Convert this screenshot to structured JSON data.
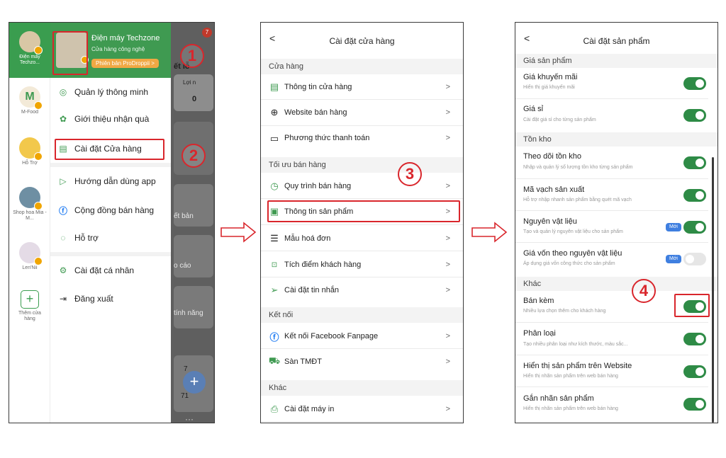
{
  "panel1": {
    "stores": [
      {
        "label": "Điện máy Techzo...",
        "active": true
      },
      {
        "label": "M-Food"
      },
      {
        "label": "Hỗ Trợ"
      },
      {
        "label": "Shop hoa Mia - M..."
      },
      {
        "label": "Len'Nii"
      },
      {
        "label": "Thêm cửa hàng"
      }
    ],
    "header": {
      "title": "Điện máy Techzone",
      "subtitle": "Cửa hàng công nghệ",
      "plan": "Phiên bản ProDroppii >"
    },
    "menu": [
      {
        "label": "Quản lý thông minh",
        "icon": "target-icon"
      },
      {
        "label": "Giới thiệu nhận quà",
        "icon": "gift-icon"
      },
      {
        "label": "Cài đặt Cửa hàng",
        "icon": "store-icon"
      },
      {
        "label": "Hướng dẫn dùng app",
        "icon": "play-icon"
      },
      {
        "label": "Cộng đồng bán hàng",
        "icon": "facebook-icon"
      },
      {
        "label": "Hỗ trợ",
        "icon": "chat-icon"
      },
      {
        "label": "Cài đặt cá nhân",
        "icon": "gear-icon"
      },
      {
        "label": "Đăng xuất",
        "icon": "logout-icon"
      }
    ],
    "background": {
      "badge": "7",
      "fragments": [
        "ết lỗ",
        "Lợi n",
        "0",
        "ết bản",
        "o cáo",
        "tính năng",
        "7",
        "71"
      ]
    }
  },
  "panel2": {
    "title": "Cài đặt cửa hàng",
    "sections": [
      {
        "title": "Cửa hàng",
        "items": [
          "Thông tin cửa hàng",
          "Website bán hàng",
          "Phương thức thanh toán"
        ]
      },
      {
        "title": "Tối ưu bán hàng",
        "items": [
          "Quy trình bán hàng",
          "Thông tin sản phẩm",
          "Mẫu hoá đơn",
          "Tích điểm khách hàng",
          "Cài đặt tin nhắn"
        ]
      },
      {
        "title": "Kết nối",
        "items": [
          "Kết nối Facebook Fanpage",
          "Sàn TMĐT"
        ]
      },
      {
        "title": "Khác",
        "items": [
          "Cài đặt máy in"
        ]
      }
    ]
  },
  "panel3": {
    "title": "Cài đặt sản phẩm",
    "sections": [
      {
        "title": "Giá sản phẩm",
        "items": [
          {
            "title": "Giá khuyến mãi",
            "desc": "Hiển thị giá khuyến mãi",
            "on": true
          },
          {
            "title": "Giá sỉ",
            "desc": "Cài đặt giá sỉ cho từng sản phẩm",
            "on": true
          }
        ]
      },
      {
        "title": "Tồn kho",
        "items": [
          {
            "title": "Theo dõi tồn kho",
            "desc": "Nhập và quản lý số lượng tồn kho từng sản phẩm",
            "on": true
          },
          {
            "title": "Mã vạch sản xuất",
            "desc": "Hỗ trợ nhập nhanh sản phẩm bằng quét mã vạch",
            "on": true
          },
          {
            "title": "Nguyên vật liệu",
            "desc": "Tạo và quản lý nguyên vật liệu cho sản phẩm",
            "on": true,
            "badge": "Mới"
          },
          {
            "title": "Giá vốn theo nguyên vật liệu",
            "desc": "Áp dụng giá vốn công thức cho sản phẩm",
            "on": false,
            "badge": "Mới"
          }
        ]
      },
      {
        "title": "Khác",
        "items": [
          {
            "title": "Bán kèm",
            "desc": "Nhiều lựa chọn thêm cho khách hàng",
            "on": true
          },
          {
            "title": "Phân loại",
            "desc": "Tạo nhiều phân loại như kích thước, màu sắc...",
            "on": true
          },
          {
            "title": "Hiển thị sản phẩm trên Website",
            "desc": "Hiển thị nhãn sản phẩm trên web bán hàng",
            "on": true
          },
          {
            "title": "Gắn nhãn sản phẩm",
            "desc": "Hiển thị nhãn sản phẩm trên web bán hàng",
            "on": true
          }
        ]
      }
    ]
  },
  "steps": [
    "1",
    "2",
    "3",
    "4"
  ],
  "colors": {
    "brand_green": "#3f9a51",
    "toggle_on": "#2e8b46",
    "highlight_red": "#d9262c",
    "badge_blue": "#3f7fe0",
    "plan_orange": "#f0a844"
  }
}
